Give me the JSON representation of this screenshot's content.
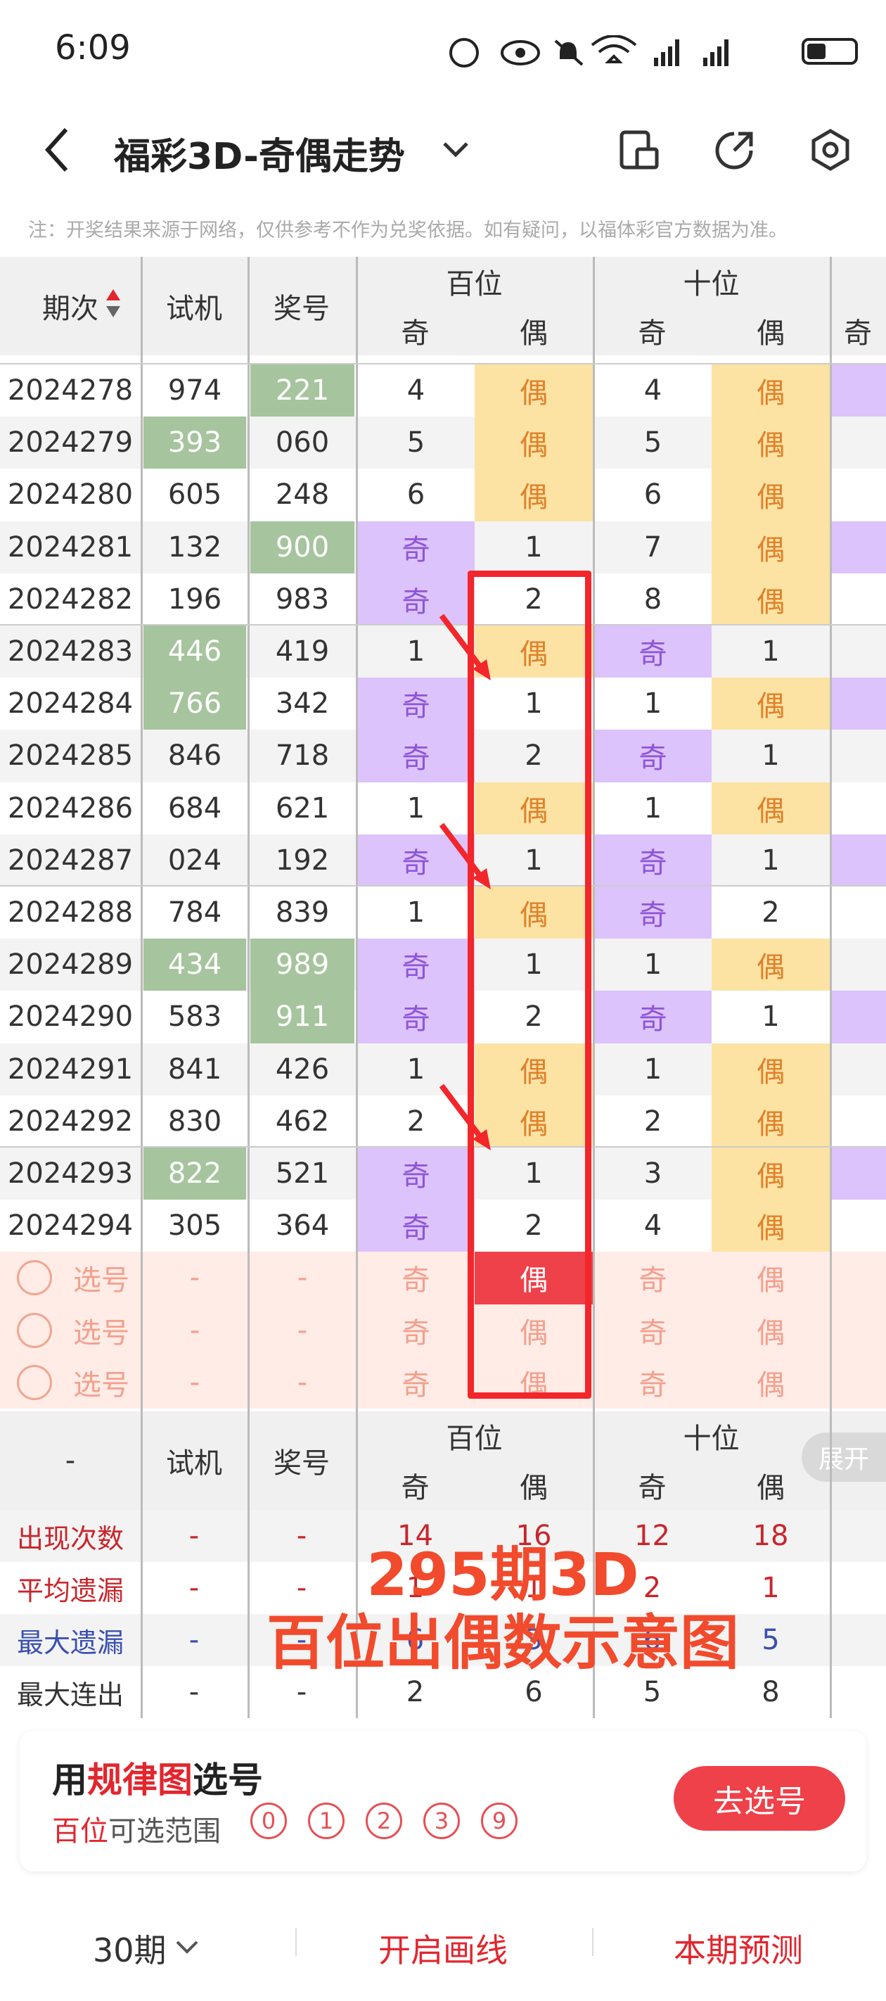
{
  "status": {
    "time": "6:09",
    "icons": [
      "nfc-icon",
      "eye-icon",
      "mute-icon",
      "wifi-icon",
      "signal-icon",
      "signal-icon",
      "battery-icon"
    ]
  },
  "header": {
    "title": "福彩3D-奇偶走势"
  },
  "notice": "注：开奖结果来源于网络，仅供参考不作为兑奖依据。如有疑问，以福体彩官方数据为准。",
  "table": {
    "col_period": "期次",
    "col_trial": "试机",
    "col_prize": "奖号",
    "group_hundreds": "百位",
    "group_tens": "十位",
    "odd": "奇",
    "even": "偶",
    "rows": [
      {
        "period": "2024278",
        "trial": "974",
        "prize": "221",
        "h_odd": "4",
        "h_even": "偶",
        "t_odd": "4",
        "t_even": "偶",
        "g": [
          0,
          1
        ],
        "hc": "e",
        "tc": "e"
      },
      {
        "period": "2024279",
        "trial": "393",
        "prize": "060",
        "h_odd": "5",
        "h_even": "偶",
        "t_odd": "5",
        "t_even": "偶",
        "g": [
          1,
          0
        ],
        "hc": "e",
        "tc": "e"
      },
      {
        "period": "2024280",
        "trial": "605",
        "prize": "248",
        "h_odd": "6",
        "h_even": "偶",
        "t_odd": "6",
        "t_even": "偶",
        "g": [
          0,
          0
        ],
        "hc": "e",
        "tc": "e"
      },
      {
        "period": "2024281",
        "trial": "132",
        "prize": "900",
        "h_odd": "奇",
        "h_even": "1",
        "t_odd": "7",
        "t_even": "偶",
        "g": [
          0,
          1
        ],
        "hc": "o",
        "tc": "e"
      },
      {
        "period": "2024282",
        "trial": "196",
        "prize": "983",
        "h_odd": "奇",
        "h_even": "2",
        "t_odd": "8",
        "t_even": "偶",
        "g": [
          0,
          0
        ],
        "hc": "o",
        "tc": "e"
      },
      {
        "period": "2024283",
        "trial": "446",
        "prize": "419",
        "h_odd": "1",
        "h_even": "偶",
        "t_odd": "奇",
        "t_even": "1",
        "g": [
          1,
          0
        ],
        "hc": "e",
        "tc": "o"
      },
      {
        "period": "2024284",
        "trial": "766",
        "prize": "342",
        "h_odd": "奇",
        "h_even": "1",
        "t_odd": "1",
        "t_even": "偶",
        "g": [
          1,
          0
        ],
        "hc": "o",
        "tc": "e"
      },
      {
        "period": "2024285",
        "trial": "846",
        "prize": "718",
        "h_odd": "奇",
        "h_even": "2",
        "t_odd": "奇",
        "t_even": "1",
        "g": [
          0,
          0
        ],
        "hc": "o",
        "tc": "o"
      },
      {
        "period": "2024286",
        "trial": "684",
        "prize": "621",
        "h_odd": "1",
        "h_even": "偶",
        "t_odd": "1",
        "t_even": "偶",
        "g": [
          0,
          0
        ],
        "hc": "e",
        "tc": "e"
      },
      {
        "period": "2024287",
        "trial": "024",
        "prize": "192",
        "h_odd": "奇",
        "h_even": "1",
        "t_odd": "奇",
        "t_even": "1",
        "g": [
          0,
          0
        ],
        "hc": "o",
        "tc": "o"
      },
      {
        "period": "2024288",
        "trial": "784",
        "prize": "839",
        "h_odd": "1",
        "h_even": "偶",
        "t_odd": "奇",
        "t_even": "2",
        "g": [
          0,
          0
        ],
        "hc": "e",
        "tc": "o"
      },
      {
        "period": "2024289",
        "trial": "434",
        "prize": "989",
        "h_odd": "奇",
        "h_even": "1",
        "t_odd": "1",
        "t_even": "偶",
        "g": [
          1,
          1
        ],
        "hc": "o",
        "tc": "e"
      },
      {
        "period": "2024290",
        "trial": "583",
        "prize": "911",
        "h_odd": "奇",
        "h_even": "2",
        "t_odd": "奇",
        "t_even": "1",
        "g": [
          0,
          1
        ],
        "hc": "o",
        "tc": "o"
      },
      {
        "period": "2024291",
        "trial": "841",
        "prize": "426",
        "h_odd": "1",
        "h_even": "偶",
        "t_odd": "1",
        "t_even": "偶",
        "g": [
          0,
          0
        ],
        "hc": "e",
        "tc": "e"
      },
      {
        "period": "2024292",
        "trial": "830",
        "prize": "462",
        "h_odd": "2",
        "h_even": "偶",
        "t_odd": "2",
        "t_even": "偶",
        "g": [
          0,
          0
        ],
        "hc": "e",
        "tc": "e"
      },
      {
        "period": "2024293",
        "trial": "822",
        "prize": "521",
        "h_odd": "奇",
        "h_even": "1",
        "t_odd": "3",
        "t_even": "偶",
        "g": [
          1,
          0
        ],
        "hc": "o",
        "tc": "e"
      },
      {
        "period": "2024294",
        "trial": "305",
        "prize": "364",
        "h_odd": "奇",
        "h_even": "2",
        "t_odd": "4",
        "t_even": "偶",
        "g": [
          0,
          0
        ],
        "hc": "o",
        "tc": "e"
      }
    ],
    "select_rows": [
      {
        "label": "选号",
        "dash": "-",
        "odd": "奇",
        "even": "偶"
      },
      {
        "label": "选号",
        "dash": "-",
        "odd": "奇",
        "even": "偶"
      },
      {
        "label": "选号",
        "dash": "-",
        "odd": "奇",
        "even": "偶"
      }
    ]
  },
  "stats": {
    "dash": "-",
    "col_trial": "试机",
    "col_prize": "奖号",
    "group_hundreds": "百位",
    "group_tens": "十位",
    "odd": "奇",
    "even": "偶",
    "expand": "展开",
    "rows": [
      {
        "label": "出现次数",
        "trial": "-",
        "prize": "-",
        "h_odd": "14",
        "h_even": "16",
        "t_odd": "12",
        "t_even": "18",
        "style": "red"
      },
      {
        "label": "平均遗漏",
        "trial": "-",
        "prize": "-",
        "h_odd": "1",
        "h_even": "1",
        "t_odd": "2",
        "t_even": "1",
        "style": "red"
      },
      {
        "label": "最大遗漏",
        "trial": "-",
        "prize": "-",
        "h_odd": "6",
        "h_even": "3",
        "t_odd": "6",
        "t_even": "5",
        "style": "blue"
      },
      {
        "label": "最大连出",
        "trial": "-",
        "prize": "-",
        "h_odd": "2",
        "h_even": "6",
        "t_odd": "5",
        "t_even": "8",
        "style": "dark"
      }
    ]
  },
  "overlay": {
    "line1": "295期3D",
    "line2": "百位出偶数示意图"
  },
  "pick": {
    "title_pre": "用",
    "title_mid": "规律图",
    "title_post": "选号",
    "sub_red": "百位",
    "sub_rest": "可选范围",
    "digits": [
      "0",
      "1",
      "2",
      "3",
      "9"
    ],
    "button": "去选号"
  },
  "bottom": {
    "periods": "30期",
    "draw": "开启画线",
    "predict": "本期预测"
  },
  "colors": {
    "odd_bg": "#dcc3fb",
    "even_bg": "#fce3a4",
    "hit_bg": "#a6c49d",
    "accent": "#ef4149"
  }
}
